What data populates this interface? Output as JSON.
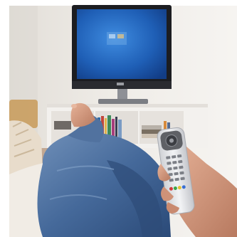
{
  "image": {
    "subject": "tv-remote-living-room",
    "palette": {
      "wall": "#ece9e4",
      "wall_shadow": "#d8d4cf",
      "tv_frame": "#1c1d21",
      "tv_screen": "#1f61b8",
      "tv_screen_glow": "#3d86d8",
      "cabinet": "#f1efec",
      "jeans": "#3c5f8e",
      "jeans_dark": "#2a4670",
      "skin": "#d59b80",
      "remote_body": "#e3e4e7",
      "remote_top": "#5c5e63",
      "sofa": "#efe9e1",
      "pillow": "#d7c6ad"
    }
  }
}
